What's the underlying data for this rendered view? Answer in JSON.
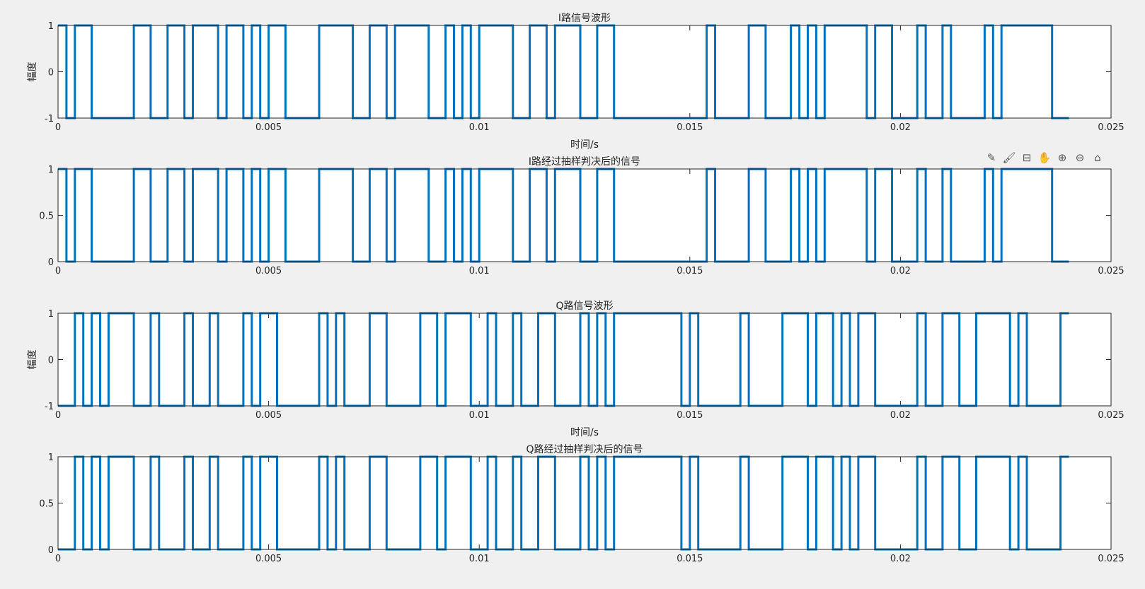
{
  "toolbar": {
    "icons": [
      "edit-icon",
      "brush-icon",
      "datatip-icon",
      "pan-hand-icon",
      "zoom-in-icon",
      "zoom-out-icon",
      "home-icon"
    ],
    "glyphs": [
      "✎",
      "🖌",
      "⊟",
      "✋",
      "⊕",
      "⊖",
      "⌂"
    ]
  },
  "chart_data": [
    {
      "type": "line",
      "title": "I路信号波形",
      "xlabel": "时间/s",
      "ylabel": "幅度",
      "xlim": [
        0,
        0.025
      ],
      "ylim": [
        -1,
        1
      ],
      "xticks": [
        "0",
        "0.005",
        "0.01",
        "0.015",
        "0.02",
        "0.025"
      ],
      "yticks": [
        "-1",
        "0",
        "1"
      ],
      "color": "#0072BD",
      "series": [
        {
          "x": [
            0,
            0.0002,
            0.0002,
            0.0004,
            0.0004,
            0.0008,
            0.0008,
            0.0018,
            0.0018,
            0.0022,
            0.0022,
            0.0026,
            0.0026,
            0.003,
            0.003,
            0.0032,
            0.0032,
            0.0038,
            0.0038,
            0.004,
            0.004,
            0.0044,
            0.0044,
            0.0046,
            0.0046,
            0.0048,
            0.0048,
            0.005,
            0.005,
            0.0054,
            0.0054,
            0.0062,
            0.0062,
            0.007,
            0.007,
            0.0074,
            0.0074,
            0.0078,
            0.0078,
            0.008,
            0.008,
            0.0088,
            0.0088,
            0.0092,
            0.0092,
            0.0094,
            0.0094,
            0.0096,
            0.0096,
            0.0098,
            0.0098,
            0.01,
            0.01,
            0.0108,
            0.0108,
            0.0112,
            0.0112,
            0.0116,
            0.0116,
            0.0118,
            0.0118,
            0.0124,
            0.0124,
            0.0128,
            0.0128,
            0.0132,
            0.0132,
            0.0154,
            0.0154,
            0.0156,
            0.0156,
            0.0164,
            0.0164,
            0.0168,
            0.0168,
            0.0174,
            0.0174,
            0.0176,
            0.0176,
            0.0178,
            0.0178,
            0.018,
            0.018,
            0.0182,
            0.0182,
            0.0192,
            0.0192,
            0.0194,
            0.0194,
            0.0198,
            0.0198,
            0.0204,
            0.0204,
            0.0206,
            0.0206,
            0.021,
            0.021,
            0.0212,
            0.0212,
            0.022,
            0.022,
            0.0222,
            0.0222,
            0.0224,
            0.0224,
            0.0236,
            0.0236,
            0.024
          ],
          "y": [
            1,
            1,
            -1,
            -1,
            1,
            1,
            -1,
            -1,
            1,
            1,
            -1,
            -1,
            1,
            1,
            -1,
            -1,
            1,
            1,
            -1,
            -1,
            1,
            1,
            -1,
            -1,
            1,
            1,
            -1,
            -1,
            1,
            1,
            -1,
            -1,
            1,
            1,
            -1,
            -1,
            1,
            1,
            -1,
            -1,
            1,
            1,
            -1,
            -1,
            1,
            1,
            -1,
            -1,
            1,
            1,
            -1,
            -1,
            1,
            1,
            -1,
            -1,
            1,
            1,
            -1,
            -1,
            1,
            1,
            -1,
            -1,
            1,
            1,
            -1,
            -1,
            1,
            1,
            -1,
            -1,
            1,
            1,
            -1,
            -1,
            1,
            1,
            -1,
            -1,
            1,
            1,
            -1,
            -1,
            1,
            1,
            -1,
            -1,
            1,
            1,
            -1,
            -1,
            1,
            1,
            -1,
            -1,
            1,
            1,
            -1,
            -1,
            1,
            1,
            -1,
            -1,
            1,
            1,
            -1,
            -1
          ]
        }
      ]
    },
    {
      "type": "line",
      "title": "I路经过抽样判决后的信号",
      "xlabel": "",
      "ylabel": "",
      "xlim": [
        0,
        0.025
      ],
      "ylim": [
        0,
        1
      ],
      "xticks": [
        "0",
        "0.005",
        "0.01",
        "0.015",
        "0.02",
        "0.025"
      ],
      "yticks": [
        "0",
        "0.5",
        "1"
      ],
      "color": "#0072BD",
      "series": [
        {
          "x": [
            0,
            0.0002,
            0.0002,
            0.0004,
            0.0004,
            0.0008,
            0.0008,
            0.0018,
            0.0018,
            0.0022,
            0.0022,
            0.0026,
            0.0026,
            0.003,
            0.003,
            0.0032,
            0.0032,
            0.0038,
            0.0038,
            0.004,
            0.004,
            0.0044,
            0.0044,
            0.0046,
            0.0046,
            0.0048,
            0.0048,
            0.005,
            0.005,
            0.0054,
            0.0054,
            0.0062,
            0.0062,
            0.007,
            0.007,
            0.0074,
            0.0074,
            0.0078,
            0.0078,
            0.008,
            0.008,
            0.0088,
            0.0088,
            0.0092,
            0.0092,
            0.0094,
            0.0094,
            0.0096,
            0.0096,
            0.0098,
            0.0098,
            0.01,
            0.01,
            0.0108,
            0.0108,
            0.0112,
            0.0112,
            0.0116,
            0.0116,
            0.0118,
            0.0118,
            0.0124,
            0.0124,
            0.0128,
            0.0128,
            0.0132,
            0.0132,
            0.0154,
            0.0154,
            0.0156,
            0.0156,
            0.0164,
            0.0164,
            0.0168,
            0.0168,
            0.0174,
            0.0174,
            0.0176,
            0.0176,
            0.0178,
            0.0178,
            0.018,
            0.018,
            0.0182,
            0.0182,
            0.0192,
            0.0192,
            0.0194,
            0.0194,
            0.0198,
            0.0198,
            0.0204,
            0.0204,
            0.0206,
            0.0206,
            0.021,
            0.021,
            0.0212,
            0.0212,
            0.022,
            0.022,
            0.0222,
            0.0222,
            0.0224,
            0.0224,
            0.0236,
            0.0236,
            0.024
          ],
          "y": [
            1,
            1,
            0,
            0,
            1,
            1,
            0,
            0,
            1,
            1,
            0,
            0,
            1,
            1,
            0,
            0,
            1,
            1,
            0,
            0,
            1,
            1,
            0,
            0,
            1,
            1,
            0,
            0,
            1,
            1,
            0,
            0,
            1,
            1,
            0,
            0,
            1,
            1,
            0,
            0,
            1,
            1,
            0,
            0,
            1,
            1,
            0,
            0,
            1,
            1,
            0,
            0,
            1,
            1,
            0,
            0,
            1,
            1,
            0,
            0,
            1,
            1,
            0,
            0,
            1,
            1,
            0,
            0,
            1,
            1,
            0,
            0,
            1,
            1,
            0,
            0,
            1,
            1,
            0,
            0,
            1,
            1,
            0,
            0,
            1,
            1,
            0,
            0,
            1,
            1,
            0,
            0,
            1,
            1,
            0,
            0,
            1,
            1,
            0,
            0,
            1,
            1,
            0,
            0,
            1,
            1,
            0,
            0
          ]
        }
      ]
    },
    {
      "type": "line",
      "title": "Q路信号波形",
      "xlabel": "时间/s",
      "ylabel": "幅度",
      "xlim": [
        0,
        0.025
      ],
      "ylim": [
        -1,
        1
      ],
      "xticks": [
        "0",
        "0.005",
        "0.01",
        "0.015",
        "0.02",
        "0.025"
      ],
      "yticks": [
        "-1",
        "0",
        "1"
      ],
      "color": "#0072BD",
      "series": [
        {
          "x": [
            0,
            0.0004,
            0.0004,
            0.0006,
            0.0006,
            0.0008,
            0.0008,
            0.001,
            0.001,
            0.0012,
            0.0012,
            0.0018,
            0.0018,
            0.0022,
            0.0022,
            0.0024,
            0.0024,
            0.003,
            0.003,
            0.0032,
            0.0032,
            0.0036,
            0.0036,
            0.0038,
            0.0038,
            0.0044,
            0.0044,
            0.0046,
            0.0046,
            0.0048,
            0.0048,
            0.0052,
            0.0052,
            0.0062,
            0.0062,
            0.0064,
            0.0064,
            0.0066,
            0.0066,
            0.0068,
            0.0068,
            0.0074,
            0.0074,
            0.0078,
            0.0078,
            0.0086,
            0.0086,
            0.009,
            0.009,
            0.0092,
            0.0092,
            0.0098,
            0.0098,
            0.0102,
            0.0102,
            0.0104,
            0.0104,
            0.0108,
            0.0108,
            0.011,
            0.011,
            0.0114,
            0.0114,
            0.0118,
            0.0118,
            0.0124,
            0.0124,
            0.0126,
            0.0126,
            0.0128,
            0.0128,
            0.013,
            0.013,
            0.0132,
            0.0132,
            0.0148,
            0.0148,
            0.015,
            0.015,
            0.0152,
            0.0152,
            0.0162,
            0.0162,
            0.0164,
            0.0164,
            0.0172,
            0.0172,
            0.0178,
            0.0178,
            0.018,
            0.018,
            0.0184,
            0.0184,
            0.0186,
            0.0186,
            0.0188,
            0.0188,
            0.019,
            0.019,
            0.0194,
            0.0194,
            0.0204,
            0.0204,
            0.0206,
            0.0206,
            0.021,
            0.021,
            0.0214,
            0.0214,
            0.0218,
            0.0218,
            0.0226,
            0.0226,
            0.0228,
            0.0228,
            0.023,
            0.023,
            0.0238,
            0.0238,
            0.024
          ],
          "y": [
            -1,
            -1,
            1,
            1,
            -1,
            -1,
            1,
            1,
            -1,
            -1,
            1,
            1,
            -1,
            -1,
            1,
            1,
            -1,
            -1,
            1,
            1,
            -1,
            -1,
            1,
            1,
            -1,
            -1,
            1,
            1,
            -1,
            -1,
            1,
            1,
            -1,
            -1,
            1,
            1,
            -1,
            -1,
            1,
            1,
            -1,
            -1,
            1,
            1,
            -1,
            -1,
            1,
            1,
            -1,
            -1,
            1,
            1,
            -1,
            -1,
            1,
            1,
            -1,
            -1,
            1,
            1,
            -1,
            -1,
            1,
            1,
            -1,
            -1,
            1,
            1,
            -1,
            -1,
            1,
            1,
            -1,
            -1,
            1,
            1,
            -1,
            -1,
            1,
            1,
            -1,
            -1,
            1,
            1,
            -1,
            -1,
            1,
            1,
            -1,
            -1,
            1,
            1,
            -1,
            -1,
            1,
            1,
            -1,
            -1,
            1,
            1,
            -1,
            -1,
            1,
            1,
            -1,
            -1,
            1,
            1,
            -1,
            -1,
            1,
            1,
            -1,
            -1,
            1,
            1,
            -1,
            -1,
            1,
            1
          ]
        }
      ]
    },
    {
      "type": "line",
      "title": "Q路经过抽样判决后的信号",
      "xlabel": "",
      "ylabel": "",
      "xlim": [
        0,
        0.025
      ],
      "ylim": [
        0,
        1
      ],
      "xticks": [
        "0",
        "0.005",
        "0.01",
        "0.015",
        "0.02",
        "0.025"
      ],
      "yticks": [
        "0",
        "0.5",
        "1"
      ],
      "color": "#0072BD",
      "series": [
        {
          "x": [
            0,
            0.0004,
            0.0004,
            0.0006,
            0.0006,
            0.0008,
            0.0008,
            0.001,
            0.001,
            0.0012,
            0.0012,
            0.0018,
            0.0018,
            0.0022,
            0.0022,
            0.0024,
            0.0024,
            0.003,
            0.003,
            0.0032,
            0.0032,
            0.0036,
            0.0036,
            0.0038,
            0.0038,
            0.0044,
            0.0044,
            0.0046,
            0.0046,
            0.0048,
            0.0048,
            0.0052,
            0.0052,
            0.0062,
            0.0062,
            0.0064,
            0.0064,
            0.0066,
            0.0066,
            0.0068,
            0.0068,
            0.0074,
            0.0074,
            0.0078,
            0.0078,
            0.0086,
            0.0086,
            0.009,
            0.009,
            0.0092,
            0.0092,
            0.0098,
            0.0098,
            0.0102,
            0.0102,
            0.0104,
            0.0104,
            0.0108,
            0.0108,
            0.011,
            0.011,
            0.0114,
            0.0114,
            0.0118,
            0.0118,
            0.0124,
            0.0124,
            0.0126,
            0.0126,
            0.0128,
            0.0128,
            0.013,
            0.013,
            0.0132,
            0.0132,
            0.0148,
            0.0148,
            0.015,
            0.015,
            0.0152,
            0.0152,
            0.0162,
            0.0162,
            0.0164,
            0.0164,
            0.0172,
            0.0172,
            0.0178,
            0.0178,
            0.018,
            0.018,
            0.0184,
            0.0184,
            0.0186,
            0.0186,
            0.0188,
            0.0188,
            0.019,
            0.019,
            0.0194,
            0.0194,
            0.0204,
            0.0204,
            0.0206,
            0.0206,
            0.021,
            0.021,
            0.0214,
            0.0214,
            0.0218,
            0.0218,
            0.0226,
            0.0226,
            0.0228,
            0.0228,
            0.023,
            0.023,
            0.0238,
            0.0238,
            0.024
          ],
          "y": [
            0,
            0,
            1,
            1,
            0,
            0,
            1,
            1,
            0,
            0,
            1,
            1,
            0,
            0,
            1,
            1,
            0,
            0,
            1,
            1,
            0,
            0,
            1,
            1,
            0,
            0,
            1,
            1,
            0,
            0,
            1,
            1,
            0,
            0,
            1,
            1,
            0,
            0,
            1,
            1,
            0,
            0,
            1,
            1,
            0,
            0,
            1,
            1,
            0,
            0,
            1,
            1,
            0,
            0,
            1,
            1,
            0,
            0,
            1,
            1,
            0,
            0,
            1,
            1,
            0,
            0,
            1,
            1,
            0,
            0,
            1,
            1,
            0,
            0,
            1,
            1,
            0,
            0,
            1,
            1,
            0,
            0,
            1,
            1,
            0,
            0,
            1,
            1,
            0,
            0,
            1,
            1,
            0,
            0,
            1,
            1,
            0,
            0,
            1,
            1,
            0,
            0,
            1,
            1,
            0,
            0,
            1,
            1,
            0,
            0,
            1,
            1,
            0,
            0,
            1,
            1,
            0,
            0,
            1,
            1
          ]
        }
      ]
    }
  ]
}
